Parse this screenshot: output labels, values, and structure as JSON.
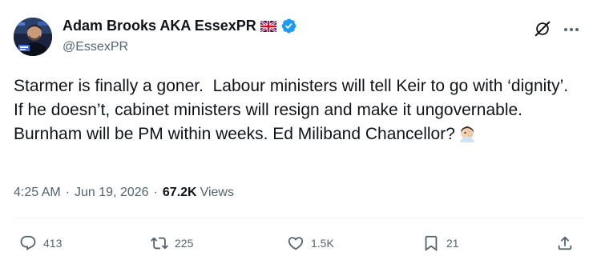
{
  "author": {
    "display_name": "Adam Brooks AKA EssexPR",
    "handle": "@EssexPR",
    "flag_icon": "uk-flag-icon",
    "verified_icon": "verified-badge-icon",
    "verified_color": "#1d9bf0"
  },
  "tweet": {
    "text": "Starmer is finally a goner.  Labour ministers will tell Keir to go with ‘dignity’. If he doesn’t, cabinet ministers will resign and make it ungovernable. Burnham will be PM within weeks. Ed Miliband Chancellor?",
    "emoji": "facepalm-emoji"
  },
  "meta": {
    "time": "4:25 AM",
    "date": "Jun 19, 2026",
    "views_count": "67.2K",
    "views_label": "Views"
  },
  "actions": {
    "replies": "413",
    "retweets": "225",
    "likes": "1.5K",
    "bookmarks": "21"
  },
  "colors": {
    "text_primary": "#0f1419",
    "text_secondary": "#536471",
    "accent": "#1d9bf0"
  }
}
